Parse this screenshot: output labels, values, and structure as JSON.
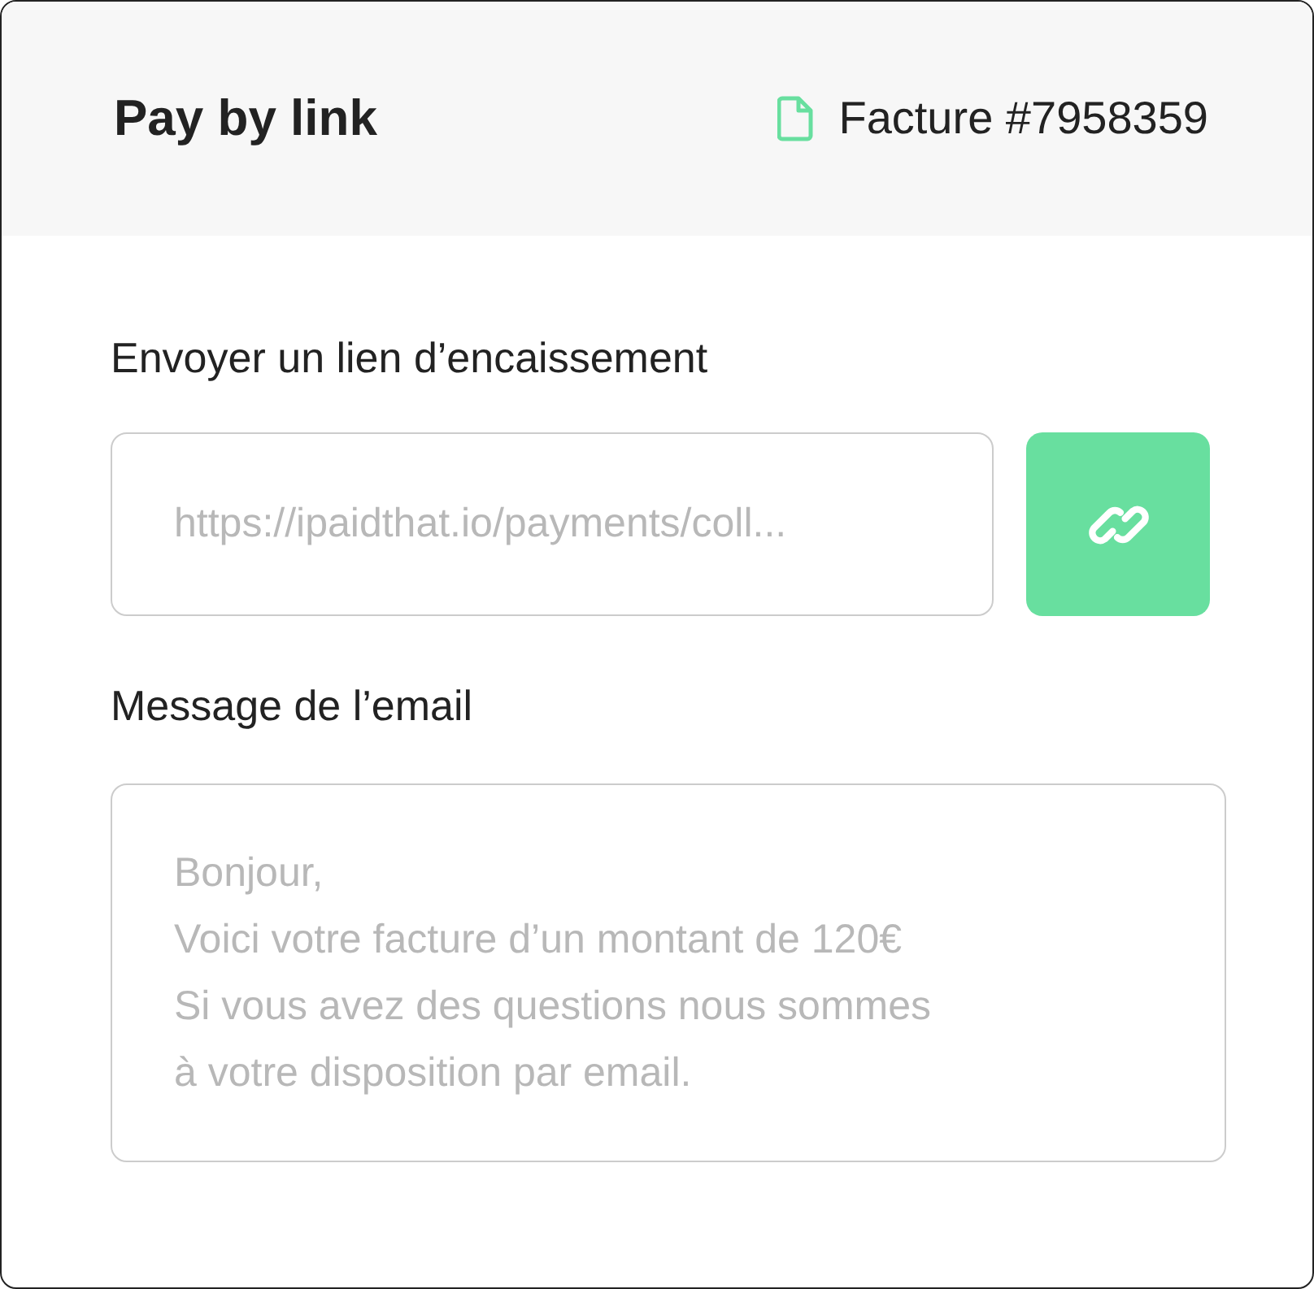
{
  "header": {
    "title": "Pay by link",
    "invoice": "Facture #7958359"
  },
  "link_section": {
    "label": "Envoyer un lien d’encaissement",
    "placeholder": "https://ipaidthat.io/payments/coll..."
  },
  "message_section": {
    "label": "Message de l’email",
    "placeholder": "Bonjour,\nVoici votre facture d’un montant de 120€\nSi vous avez des questions nous sommes\nà votre disposition par email."
  }
}
